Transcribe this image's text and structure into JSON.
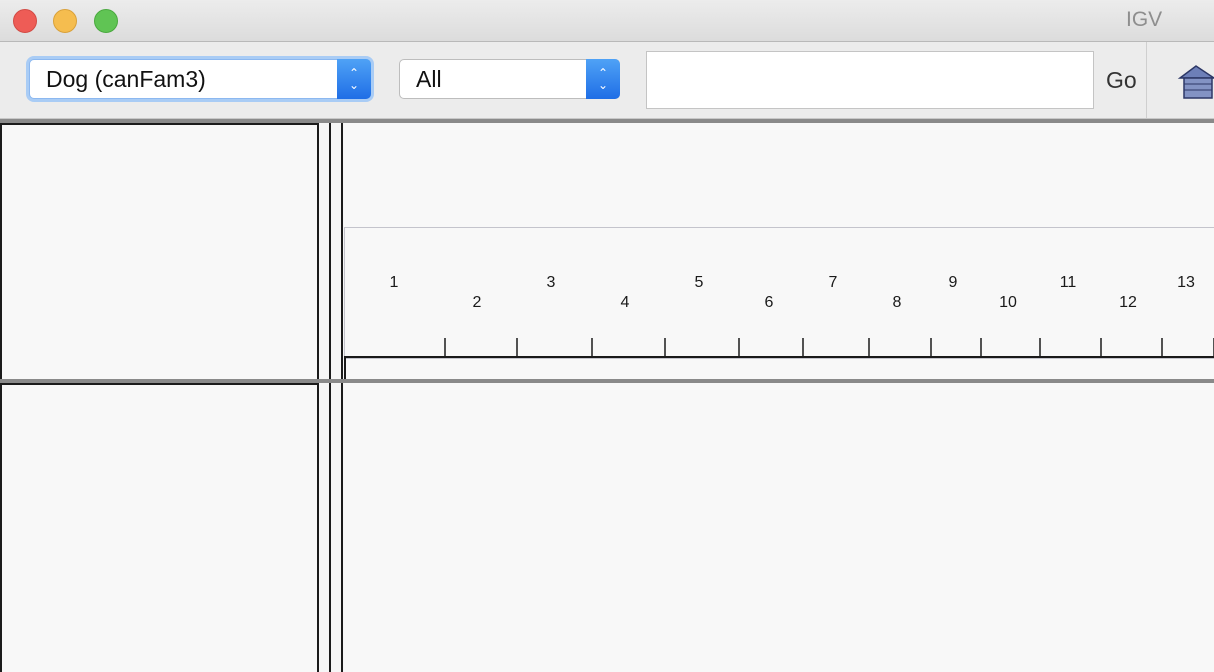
{
  "window": {
    "title": "IGV"
  },
  "toolbar": {
    "genome_select": {
      "value": "Dog (canFam3)"
    },
    "chromosome_select": {
      "value": "All"
    },
    "locus_input": {
      "value": "",
      "placeholder": ""
    },
    "go_label": "Go",
    "home_icon": "home-icon"
  },
  "ruler": {
    "chromosomes": [
      "1",
      "2",
      "3",
      "4",
      "5",
      "6",
      "7",
      "8",
      "9",
      "10",
      "11",
      "12",
      "13"
    ]
  },
  "colors": {
    "close": "#ee5c56",
    "minimize": "#f5bd4f",
    "maximize": "#60c454",
    "stepper_accent": "#1f6ee6",
    "focus_ring": "#a9ccf5"
  }
}
